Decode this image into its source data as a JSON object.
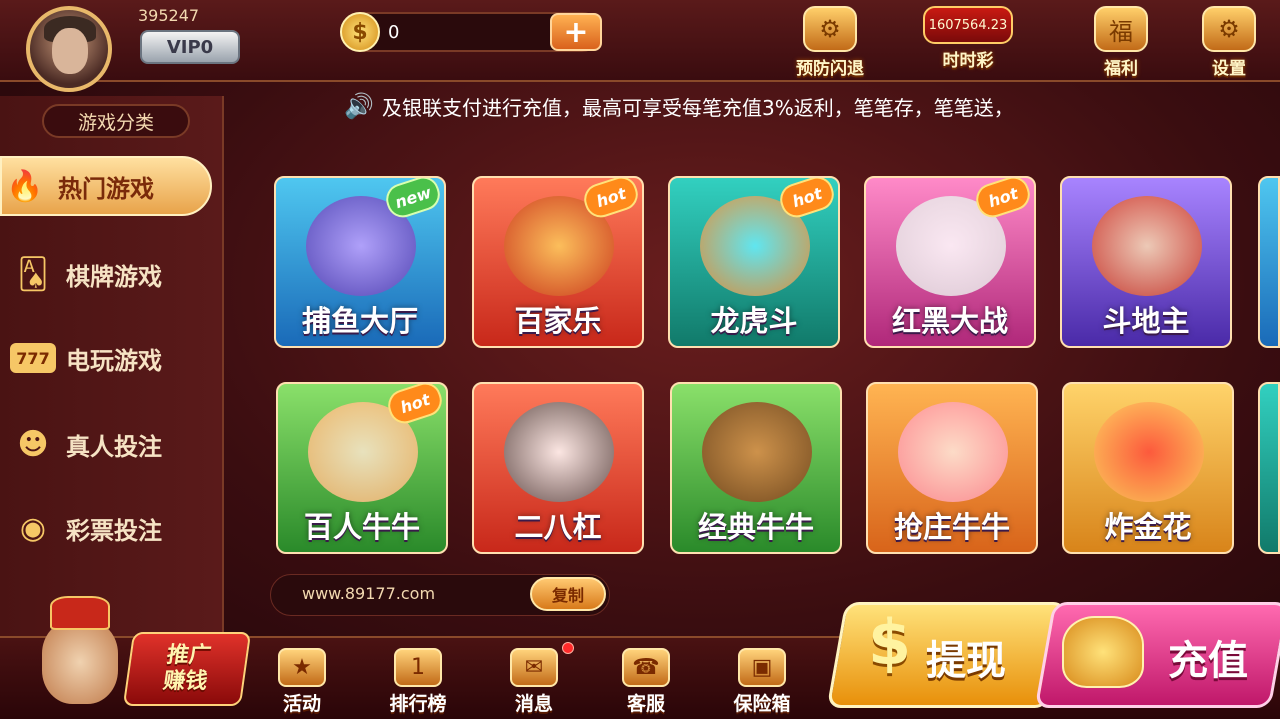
{
  "profile": {
    "uid": "395247",
    "vip": "VIP0"
  },
  "wallet": {
    "balance": "0",
    "coin_icon": "$",
    "add_icon": "+"
  },
  "top_buttons": [
    {
      "label": "预防闪退",
      "icon": "gear-icon",
      "glyph": "⚙"
    },
    {
      "label": "时时彩",
      "value": "1607564.23",
      "icon": "lottery-icon"
    },
    {
      "label": "福利",
      "icon": "gift-icon",
      "glyph": "福"
    },
    {
      "label": "设置",
      "icon": "gear-icon",
      "glyph": "⚙"
    }
  ],
  "marquee": {
    "text": "及银联支付进行充值，最高可享受每笔充值3%返利，笔笔存，笔笔送，"
  },
  "sidebar": {
    "title": "游戏分类",
    "items": [
      {
        "label": "热门游戏",
        "icon": "flame-icon",
        "glyph": "🔥",
        "active": true
      },
      {
        "label": "棋牌游戏",
        "icon": "cards-icon",
        "glyph": "🂡"
      },
      {
        "label": "电玩游戏",
        "icon": "slot-icon",
        "glyph": "777"
      },
      {
        "label": "真人投注",
        "icon": "person-icon",
        "glyph": "☻"
      },
      {
        "label": "彩票投注",
        "icon": "lottery-ball-icon",
        "glyph": "◉"
      }
    ]
  },
  "games": [
    {
      "name": "捕鱼大厅",
      "badge": "new"
    },
    {
      "name": "百家乐",
      "badge": "hot"
    },
    {
      "name": "龙虎斗",
      "badge": "hot"
    },
    {
      "name": "红黑大战",
      "badge": "hot"
    },
    {
      "name": "斗地主",
      "badge": ""
    },
    {
      "name": "百人牛牛",
      "badge": "hot"
    },
    {
      "name": "二八杠",
      "badge": ""
    },
    {
      "name": "经典牛牛",
      "badge": ""
    },
    {
      "name": "抢庄牛牛",
      "badge": ""
    },
    {
      "name": "炸金花",
      "badge": ""
    }
  ],
  "promo": {
    "line1": "推广",
    "line2": "赚钱"
  },
  "share": {
    "url": "www.89177.com",
    "copy_label": "复制"
  },
  "bottom_nav": [
    {
      "label": "活动",
      "icon": "gift-box-icon",
      "glyph": "★"
    },
    {
      "label": "排行榜",
      "icon": "podium-icon",
      "glyph": "1"
    },
    {
      "label": "消息",
      "icon": "mail-icon",
      "glyph": "✉"
    },
    {
      "label": "客服",
      "icon": "headset-icon",
      "glyph": "☎"
    },
    {
      "label": "保险箱",
      "icon": "safe-icon",
      "glyph": "▣"
    }
  ],
  "actions": {
    "withdraw": "提现",
    "withdraw_icon": "$",
    "deposit": "充值"
  }
}
